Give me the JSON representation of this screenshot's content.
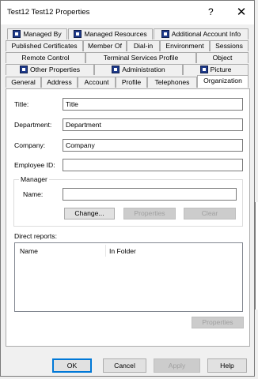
{
  "window": {
    "title": "Test12 Test12 Properties",
    "help_glyph": "?",
    "close_glyph": "✕"
  },
  "tabs": {
    "row1": [
      "Managed By",
      "Managed Resources",
      "Additional Account Info"
    ],
    "row2": [
      "Published Certificates",
      "Member Of",
      "Dial-in",
      "Environment",
      "Sessions"
    ],
    "row3": [
      "Remote Control",
      "Terminal Services Profile",
      "Object"
    ],
    "row4": [
      "Other Properties",
      "Administration",
      "Picture"
    ],
    "row5": [
      "General",
      "Address",
      "Account",
      "Profile",
      "Telephones",
      "Organization"
    ],
    "selected": "Organization"
  },
  "form": {
    "title_label": "Title:",
    "title_value": "Title",
    "department_label": "Department:",
    "department_value": "Department",
    "company_label": "Company:",
    "company_value": "Company",
    "employee_id_label": "Employee ID:",
    "employee_id_value": "",
    "manager_group": "Manager",
    "manager_name_label": "Name:",
    "manager_name_value": "",
    "change_button": "Change...",
    "properties_button": "Properties",
    "clear_button": "Clear",
    "direct_reports_label": "Direct reports:",
    "columns": [
      "Name",
      "In Folder"
    ],
    "reports_properties_button": "Properties"
  },
  "footer": {
    "ok": "OK",
    "cancel": "Cancel",
    "apply": "Apply",
    "help": "Help"
  },
  "colors": {
    "accent": "#0078d7",
    "tab_icon": "#1e3a8a"
  }
}
